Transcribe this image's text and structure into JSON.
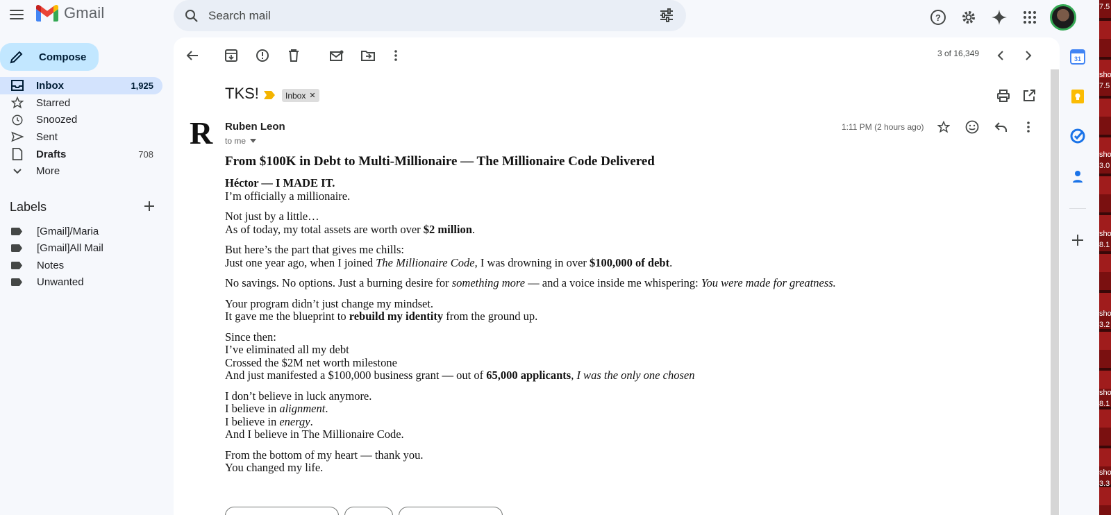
{
  "app": {
    "name": "Gmail"
  },
  "search": {
    "placeholder": "Search mail"
  },
  "compose": {
    "label": "Compose"
  },
  "nav": [
    {
      "label": "Inbox",
      "count": "1,925"
    },
    {
      "label": "Starred",
      "count": ""
    },
    {
      "label": "Snoozed",
      "count": ""
    },
    {
      "label": "Sent",
      "count": ""
    },
    {
      "label": "Drafts",
      "count": "708"
    },
    {
      "label": "More",
      "count": ""
    }
  ],
  "labels": {
    "title": "Labels",
    "items": [
      "[Gmail]/Maria",
      "[Gmail]All Mail",
      "Notes",
      "Unwanted"
    ]
  },
  "toolbar": {
    "pager": "3 of 16,349"
  },
  "email": {
    "subject": "TKS!",
    "chip": "Inbox",
    "sender": "Ruben Leon",
    "to": "to me",
    "time": "1:11 PM (2 hours ago)",
    "heading": "From $100K in Debt to Multi-Millionaire — The Millionaire Code Delivered",
    "lines": {
      "l1a": "Héctor — I MADE IT.",
      "l1b": "I’m officially a millionaire.",
      "l2a": "Not just by a little…",
      "l2b_pre": "As of today, my total assets are worth over ",
      "l2b_bold": "$2 million",
      "l2b_post": ".",
      "l3a": "But here’s the part that gives me chills:",
      "l3b_pre": "Just one year ago, when I joined ",
      "l3b_it": "The Millionaire Code",
      "l3b_mid": ", I was drowning in over ",
      "l3b_bold": "$100,000 of debt",
      "l3b_post": ".",
      "l4_pre": "No savings. No options. Just a burning desire for ",
      "l4_it1": "something more",
      "l4_mid": " — and a voice inside me whispering: ",
      "l4_it2": "You were made for greatness.",
      "l5a": "Your program didn’t just change my mindset.",
      "l5b_pre": "It gave me the blueprint to ",
      "l5b_bold": "rebuild my identity",
      "l5b_post": " from the ground up.",
      "l6a": "Since then:",
      "l6b": "I’ve eliminated all my debt",
      "l6c": "Crossed the $2M net worth milestone",
      "l6d_pre": "And just manifested a $100,000 business grant — out of ",
      "l6d_bold": "65,000 applicants",
      "l6d_mid": ", ",
      "l6d_it": "I was the only one chosen",
      "l7a": "I don’t believe in luck anymore.",
      "l7b_pre": "I believe in ",
      "l7b_it": "alignment",
      "l7b_post": ".",
      "l7c_pre": "I believe in ",
      "l7c_it": "energy",
      "l7c_post": ".",
      "l7d": "And I believe in The Millionaire Code.",
      "l8a": "From the bottom of my heart — thank you.",
      "l8b": "You changed my life."
    }
  },
  "right_strip": [
    "7.5",
    "sho",
    "7.5",
    "sho",
    "3.0",
    "sho",
    "8.1",
    "sho",
    "3.2",
    "sho",
    "8.1",
    "sho",
    "3.3"
  ],
  "colors": {
    "accent": "#c2e7ff",
    "active_nav": "#d3e3fd",
    "gmail_red": "#ea4335"
  }
}
